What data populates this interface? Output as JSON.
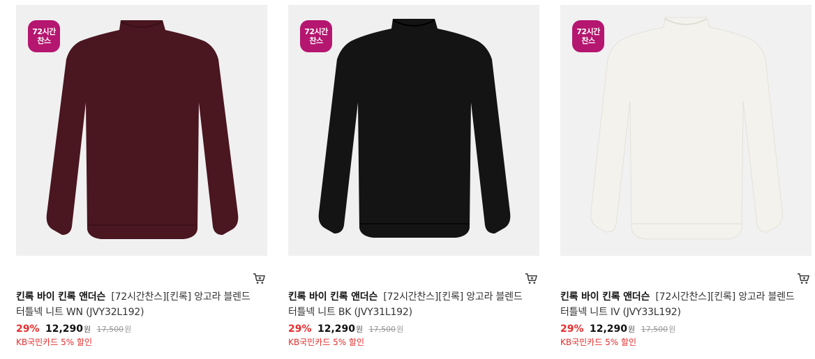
{
  "products": [
    {
      "badge_line1": "72시간",
      "badge_line2": "찬스",
      "brand": "킨록 바이 킨록 앤더슨",
      "name": "[72시간찬스][킨록] 앙고라 블렌드 터틀넥 니트 WN (JVY32L192)",
      "discount_rate": "29%",
      "price": "12,290",
      "price_unit": "원",
      "original_price": "17,500",
      "original_unit": "원",
      "promo": "KB국민카드 5% 할인",
      "color": "#4a1620",
      "icon": "cart-icon"
    },
    {
      "badge_line1": "72시간",
      "badge_line2": "찬스",
      "brand": "킨록 바이 킨록 앤더슨",
      "name": "[72시간찬스][킨록] 앙고라 블렌드 터틀넥 니트 BK (JVY31L192)",
      "discount_rate": "29%",
      "price": "12,290",
      "price_unit": "원",
      "original_price": "17,500",
      "original_unit": "원",
      "promo": "KB국민카드 5% 할인",
      "color": "#141414",
      "icon": "cart-icon"
    },
    {
      "badge_line1": "72시간",
      "badge_line2": "찬스",
      "brand": "킨록 바이 킨록 앤더슨",
      "name": "[72시간찬스][킨록] 앙고라 블렌드 터틀넥 니트 IV (JVY33L192)",
      "discount_rate": "29%",
      "price": "12,290",
      "price_unit": "원",
      "original_price": "17,500",
      "original_unit": "원",
      "promo": "KB국민카드 5% 할인",
      "color": "#f4f2ec",
      "icon": "cart-icon"
    }
  ],
  "colors": {
    "badge": "#b5166f",
    "discount": "#e62e2e"
  }
}
